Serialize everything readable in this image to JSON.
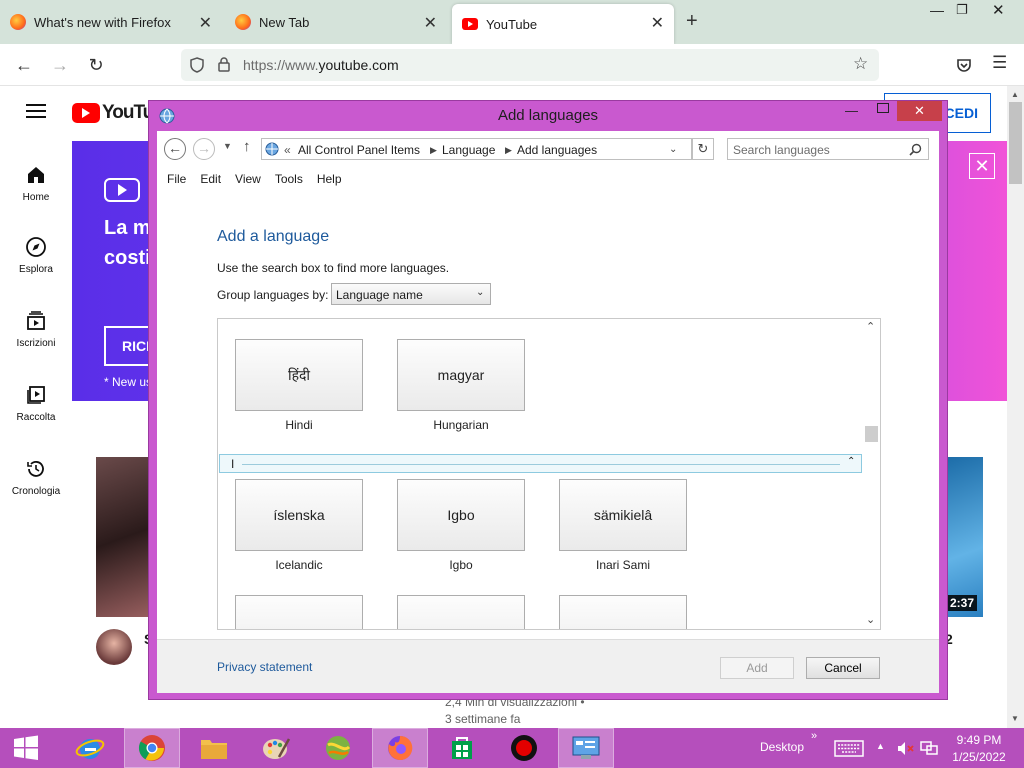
{
  "browser": {
    "tabs": [
      {
        "label": "What's new with Firefox"
      },
      {
        "label": "New Tab"
      },
      {
        "label": "YouTube"
      }
    ],
    "url_prefix": "https://www.",
    "url_domain": "youtube.com"
  },
  "youtube": {
    "logo": "YouTube",
    "sidebar": [
      {
        "label": "Home",
        "icon": "home-icon"
      },
      {
        "label": "Esplora",
        "icon": "compass-icon"
      },
      {
        "label": "Iscrizioni",
        "icon": "subscriptions-icon"
      },
      {
        "label": "Raccolta",
        "icon": "library-icon"
      },
      {
        "label": "Cronologia",
        "icon": "history-icon"
      }
    ],
    "signin_label": "CEDI",
    "banner_line1": "La m",
    "banner_line2": "costi",
    "banner_btn": "RICI",
    "banner_note": "* New us",
    "video_duration": "2:37",
    "video_title_frag": "S",
    "video_title_frag2": "2",
    "views": "2,4 Mln di visualizzazioni •",
    "ago": "3 settimane fa"
  },
  "dialog": {
    "title": "Add languages",
    "breadcrumb": [
      "All Control Panel Items",
      "Language",
      "Add languages"
    ],
    "search_placeholder": "Search languages",
    "menu": [
      "File",
      "Edit",
      "View",
      "Tools",
      "Help"
    ],
    "heading": "Add a language",
    "instruction": "Use the search box to find more languages.",
    "group_label": "Group languages by:",
    "group_value": "Language name",
    "group_header": "I",
    "languages_h": [
      {
        "native": "हिंदी",
        "english": "Hindi"
      },
      {
        "native": "magyar",
        "english": "Hungarian"
      }
    ],
    "languages_i": [
      {
        "native": "íslenska",
        "english": "Icelandic"
      },
      {
        "native": "Igbo",
        "english": "Igbo"
      },
      {
        "native": "sämikielâ",
        "english": "Inari Sami"
      }
    ],
    "privacy": "Privacy statement",
    "add_label": "Add",
    "cancel_label": "Cancel"
  },
  "taskbar": {
    "desktop_label": "Desktop",
    "time": "9:49 PM",
    "date": "1/25/2022"
  },
  "colors": {
    "taskbar": "#b54fbc",
    "dialog_frame": "#c959cf",
    "yt_red": "#ff0000",
    "link_blue": "#1e5a9c"
  }
}
